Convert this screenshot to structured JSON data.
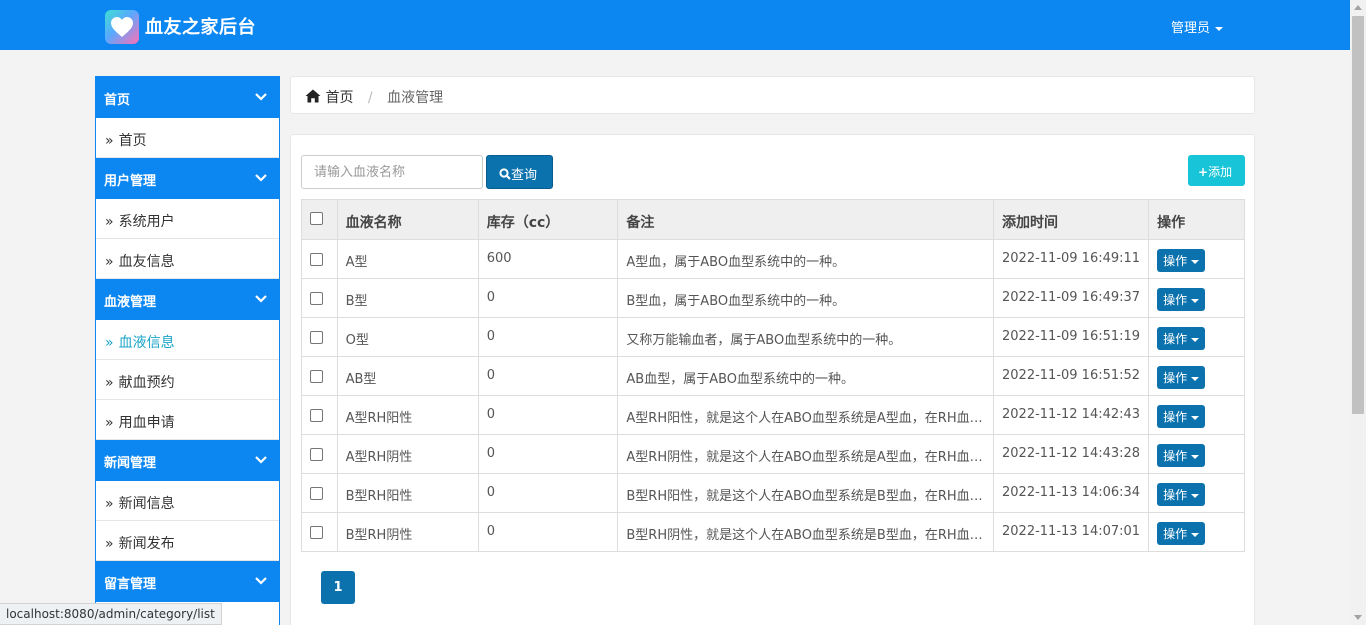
{
  "header": {
    "brand": "血友之家后台",
    "user_menu": "管理员"
  },
  "sidebar": {
    "groups": [
      {
        "title": "首页",
        "items": [
          "首页"
        ]
      },
      {
        "title": "用户管理",
        "items": [
          "系统用户",
          "血友信息"
        ]
      },
      {
        "title": "血液管理",
        "items": [
          "血液信息",
          "献血预约",
          "用血申请"
        ]
      },
      {
        "title": "新闻管理",
        "items": [
          "新闻信息",
          "新闻发布"
        ]
      },
      {
        "title": "留言管理",
        "items": []
      }
    ],
    "active_item": "血液信息"
  },
  "breadcrumb": {
    "home": "首页",
    "current": "血液管理"
  },
  "toolbar": {
    "search_placeholder": "请输入血液名称",
    "query_label": "查询",
    "add_label": "添加"
  },
  "table": {
    "columns": [
      "血液名称",
      "库存（cc）",
      "备注",
      "添加时间",
      "操作"
    ],
    "rows": [
      {
        "name": "A型",
        "stock": "600",
        "note": "A型血，属于ABO血型系统中的一种。",
        "time": "2022-11-09 16:49:11",
        "action": "操作"
      },
      {
        "name": "B型",
        "stock": "0",
        "note": "B型血，属于ABO血型系统中的一种。",
        "time": "2022-11-09 16:49:37",
        "action": "操作"
      },
      {
        "name": "O型",
        "stock": "0",
        "note": "又称万能输血者，属于ABO血型系统中的一种。",
        "time": "2022-11-09 16:51:19",
        "action": "操作"
      },
      {
        "name": "AB型",
        "stock": "0",
        "note": "AB血型，属于ABO血型系统中的一种。",
        "time": "2022-11-09 16:51:52",
        "action": "操作"
      },
      {
        "name": "A型RH阳性",
        "stock": "0",
        "note": "A型RH阳性，就是这个人在ABO血型系统是A型血，在RH血型系...",
        "time": "2022-11-12 14:42:43",
        "action": "操作"
      },
      {
        "name": "A型RH阴性",
        "stock": "0",
        "note": "A型RH阴性，就是这个人在ABO血型系统是A型血，在RH血型系...",
        "time": "2022-11-12 14:43:28",
        "action": "操作"
      },
      {
        "name": "B型RH阳性",
        "stock": "0",
        "note": "B型RH阳性，就是这个人在ABO血型系统是B型血，在RH血型系...",
        "time": "2022-11-13 14:06:34",
        "action": "操作"
      },
      {
        "name": "B型RH阴性",
        "stock": "0",
        "note": "B型RH阴性，就是这个人在ABO血型系统是B型血，在RH血型系...",
        "time": "2022-11-13 14:07:01",
        "action": "操作"
      }
    ]
  },
  "pagination": {
    "current_page": "1"
  },
  "status_bar": {
    "url": "localhost:8080/admin/category/list"
  }
}
